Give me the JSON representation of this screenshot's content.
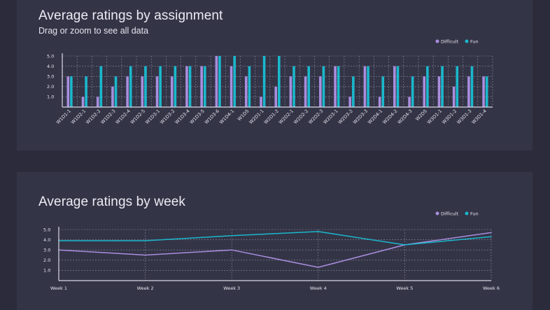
{
  "colors": {
    "difficult": "#a98ede",
    "fun": "#1ab8cc",
    "grid": "#8a8aa0",
    "axis": "#d8d8e4"
  },
  "chart_data": [
    {
      "type": "bar",
      "title": "Average ratings by assignment",
      "subtitle": "Drag or zoom to see all data",
      "legend_position": "top-right",
      "grid": true,
      "ylim": [
        0,
        5
      ],
      "yticks": [
        "1.0",
        "2.0",
        "3.0",
        "4.0",
        "5.0"
      ],
      "categories": [
        "W1D1-1",
        "W1D2-1",
        "W1D2-2",
        "W1D2-3",
        "W1D2-4",
        "W1D2-5",
        "W1D3-1",
        "W1D3-2",
        "W1D3-4",
        "W1D3-5",
        "W1D3-6",
        "W1D4-1",
        "W1D5",
        "W2D1-1",
        "W2D1-2",
        "W2D2-1",
        "W2D2-2",
        "W2D2-3",
        "W2D3-1",
        "W2D3-2",
        "W2D3-3",
        "W2D4-1",
        "W2D4-2",
        "W2D4-3",
        "W2D5",
        "W3D1-1",
        "W3D1-2",
        "W3D1-3",
        "W3D1-4"
      ],
      "series": [
        {
          "name": "Difficult",
          "values": [
            3,
            1,
            1,
            2,
            3,
            3,
            3,
            3,
            4,
            4,
            5,
            4,
            3,
            1,
            2,
            3,
            3,
            3,
            4,
            1,
            4,
            1,
            4,
            1,
            3,
            3,
            2,
            3,
            3
          ]
        },
        {
          "name": "Fun",
          "values": [
            3,
            3,
            4,
            3,
            4,
            4,
            4,
            4,
            4,
            4,
            5,
            5,
            4,
            5,
            5,
            4,
            4,
            4,
            4,
            3,
            4,
            3,
            4,
            3,
            4,
            4,
            4,
            4,
            3
          ]
        }
      ]
    },
    {
      "type": "line",
      "title": "Average ratings by week",
      "legend_position": "top-right",
      "grid": true,
      "ylim": [
        0,
        5
      ],
      "yticks": [
        "1.0",
        "2.0",
        "3.0",
        "4.0",
        "5.0"
      ],
      "categories": [
        "Week 1",
        "Week 2",
        "Week 3",
        "Week 4",
        "Week 5",
        "Week 6"
      ],
      "series": [
        {
          "name": "Difficult",
          "values": [
            3.0,
            2.5,
            3.0,
            1.3,
            3.5,
            4.7
          ]
        },
        {
          "name": "Fun",
          "values": [
            3.9,
            3.9,
            4.4,
            4.8,
            3.5,
            4.3
          ]
        }
      ]
    }
  ]
}
